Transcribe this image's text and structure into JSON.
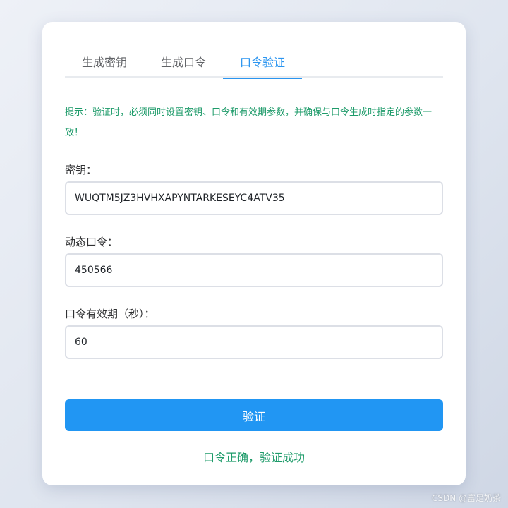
{
  "tabs": [
    {
      "label": "生成密钥",
      "active": false
    },
    {
      "label": "生成口令",
      "active": false
    },
    {
      "label": "口令验证",
      "active": true
    }
  ],
  "hint": "提示：验证时，必须同时设置密钥、口令和有效期参数，并确保与口令生成时指定的参数一致！",
  "fields": {
    "secret": {
      "label": "密钥：",
      "value": "WUQTM5JZ3HVHXAPYNTARKESEYC4ATV35"
    },
    "code": {
      "label": "动态口令：",
      "value": "450566"
    },
    "period": {
      "label": "口令有效期（秒）：",
      "value": "60"
    }
  },
  "verify_button": "验证",
  "result": "口令正确，验证成功",
  "watermark": "CSDN @富足奶茶",
  "colors": {
    "accent": "#2196f3",
    "success": "#1e9b6a",
    "background": "#dfe5ef"
  }
}
